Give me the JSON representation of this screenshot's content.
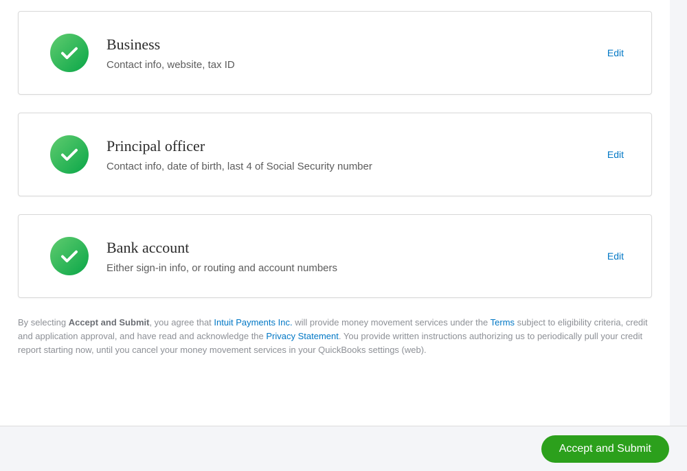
{
  "cards": [
    {
      "title": "Business",
      "subtitle": "Contact info, website, tax ID",
      "edit": "Edit"
    },
    {
      "title": "Principal officer",
      "subtitle": "Contact info, date of birth, last 4 of Social Security number",
      "edit": "Edit"
    },
    {
      "title": "Bank account",
      "subtitle": "Either sign-in info, or routing and account numbers",
      "edit": "Edit"
    }
  ],
  "disclosure": {
    "prefix": "By selecting ",
    "bold": "Accept and Submit",
    "seg1": ", you agree that ",
    "link1": "Intuit Payments Inc.",
    "seg2": " will provide money movement services under the ",
    "link2": "Terms",
    "seg3": " subject to eligibility criteria, credit and application approval, and have read and acknowledge the ",
    "link3": "Privacy Statement",
    "seg4": ". You provide written instructions authorizing us to periodically pull your credit report starting now, until you cancel your money movement services in your QuickBooks settings (web)."
  },
  "footer": {
    "submit": "Accept and Submit"
  }
}
